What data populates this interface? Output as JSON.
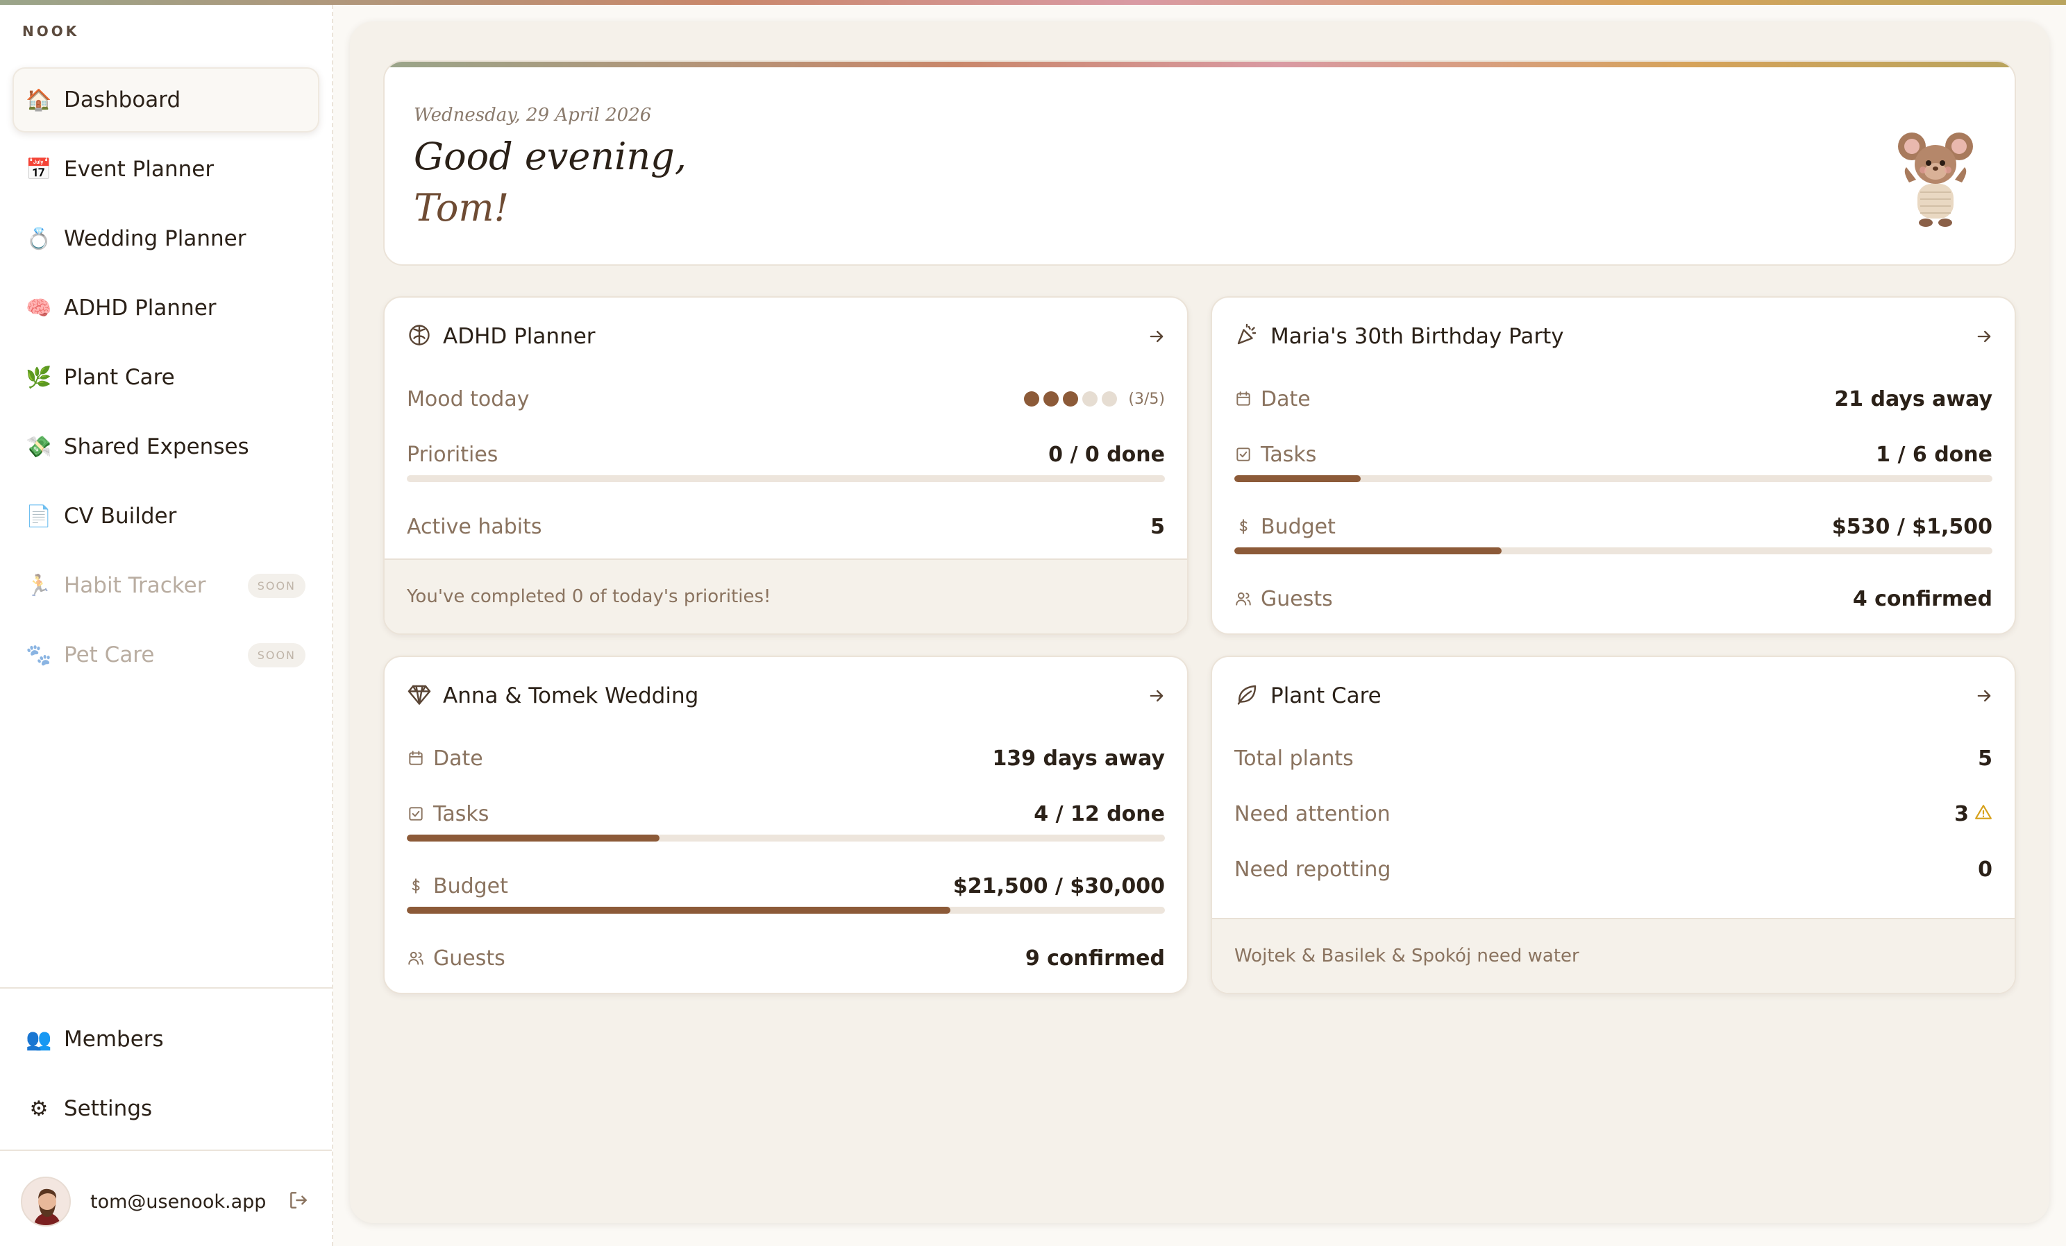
{
  "app": {
    "brand": "NOOK"
  },
  "sidebar": {
    "items": [
      {
        "label": "Dashboard",
        "icon": "house-icon",
        "glyph": "🏠",
        "active": true
      },
      {
        "label": "Event Planner",
        "icon": "calendar-icon",
        "glyph": "📅"
      },
      {
        "label": "Wedding Planner",
        "icon": "ring-icon",
        "glyph": "💍"
      },
      {
        "label": "ADHD Planner",
        "icon": "brain-icon",
        "glyph": "🧠"
      },
      {
        "label": "Plant Care",
        "icon": "herb-icon",
        "glyph": "🌿"
      },
      {
        "label": "Shared Expenses",
        "icon": "money-icon",
        "glyph": "💸"
      },
      {
        "label": "CV Builder",
        "icon": "document-icon",
        "glyph": "📄"
      },
      {
        "label": "Habit Tracker",
        "icon": "running-icon",
        "glyph": "🏃",
        "badge": "SOON"
      },
      {
        "label": "Pet Care",
        "icon": "paw-icon",
        "glyph": "🐾",
        "badge": "SOON"
      }
    ],
    "bottom": [
      {
        "label": "Members",
        "icon": "people-icon",
        "glyph": "👥"
      },
      {
        "label": "Settings",
        "icon": "gear-icon",
        "glyph": "⚙"
      }
    ],
    "user": {
      "email": "tom@usenook.app"
    }
  },
  "hero": {
    "date": "Wednesday, 29 April 2026",
    "greeting": "Good evening,",
    "name": "Tom!"
  },
  "cards": {
    "adhd": {
      "title": "ADHD Planner",
      "mood_label": "Mood today",
      "mood_value": 3,
      "mood_max": 5,
      "mood_count": "(3/5)",
      "priorities_label": "Priorities",
      "priorities_value": "0 / 0 done",
      "priorities_progress": 0,
      "habits_label": "Active habits",
      "habits_value": "5",
      "footer": "You've completed 0 of today's priorities!"
    },
    "party": {
      "title": "Maria's 30th Birthday Party",
      "date_label": "Date",
      "date_value": "21 days away",
      "tasks_label": "Tasks",
      "tasks_value": "1 / 6 done",
      "tasks_progress": 0.167,
      "budget_label": "Budget",
      "budget_value": "$530 / $1,500",
      "budget_progress": 0.353,
      "guests_label": "Guests",
      "guests_value": "4 confirmed"
    },
    "wedding": {
      "title": "Anna & Tomek Wedding",
      "date_label": "Date",
      "date_value": "139 days away",
      "tasks_label": "Tasks",
      "tasks_value": "4 / 12 done",
      "tasks_progress": 0.333,
      "budget_label": "Budget",
      "budget_value": "$21,500 / $30,000",
      "budget_progress": 0.717,
      "guests_label": "Guests",
      "guests_value": "9 confirmed"
    },
    "plants": {
      "title": "Plant Care",
      "total_label": "Total plants",
      "total_value": "5",
      "attention_label": "Need attention",
      "attention_value": "3",
      "repot_label": "Need repotting",
      "repot_value": "0",
      "footer": "Wojtek & Basilek & Spokój need water"
    }
  },
  "colors": {
    "accent": "#8c5a38",
    "track": "#ede5dc",
    "muted": "#8a735f"
  }
}
